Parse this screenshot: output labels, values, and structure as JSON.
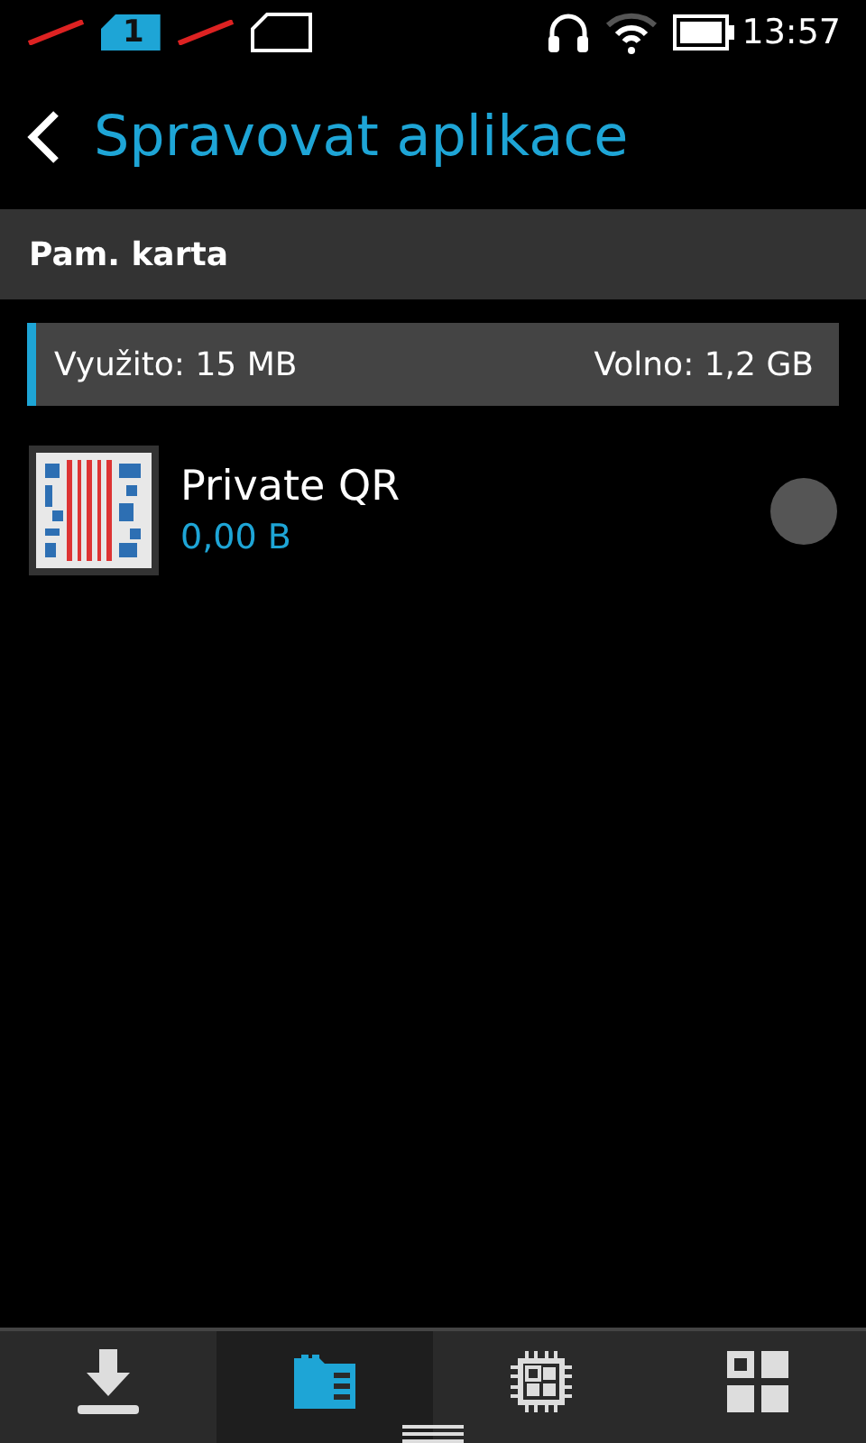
{
  "status_bar": {
    "sim_label": "1",
    "time": "13:57"
  },
  "header": {
    "title": "Spravovat aplikace"
  },
  "section": {
    "title": "Pam. karta"
  },
  "storage": {
    "used": "Využito: 15 MB",
    "free": "Volno: 1,2 GB"
  },
  "apps": [
    {
      "name": "Private QR",
      "size": "0,00 B",
      "checked": false
    }
  ],
  "nav_tabs": [
    {
      "kind": "download",
      "selected": false
    },
    {
      "kind": "card",
      "selected": true
    },
    {
      "kind": "chip",
      "selected": false
    },
    {
      "kind": "apps",
      "selected": false
    }
  ]
}
